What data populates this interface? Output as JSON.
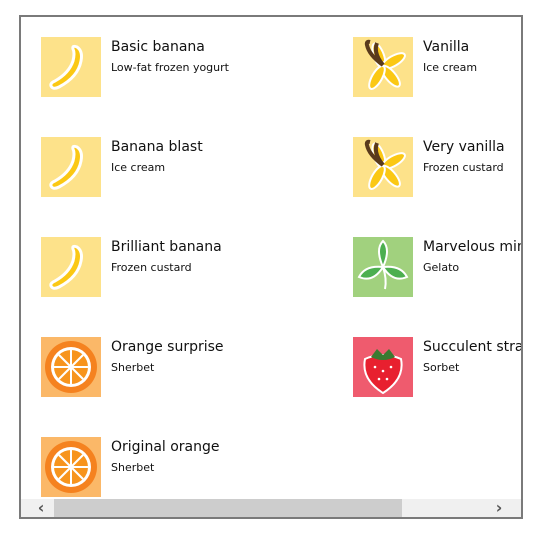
{
  "items": [
    {
      "title": "Basic banana",
      "subtitle": "Low-fat frozen yogurt",
      "icon": "banana-icon",
      "bg": "#fde28a"
    },
    {
      "title": "Banana blast",
      "subtitle": "Ice cream",
      "icon": "banana-icon",
      "bg": "#fde28a"
    },
    {
      "title": "Brilliant banana",
      "subtitle": "Frozen custard",
      "icon": "banana-icon",
      "bg": "#fde28a"
    },
    {
      "title": "Orange surprise",
      "subtitle": "Sherbet",
      "icon": "orange-icon",
      "bg": "#fbb868"
    },
    {
      "title": "Original orange",
      "subtitle": "Sherbet",
      "icon": "orange-icon",
      "bg": "#fbb868"
    },
    {
      "title": "Vanilla",
      "subtitle": "Ice cream",
      "icon": "vanilla-icon",
      "bg": "#fde28a"
    },
    {
      "title": "Very vanilla",
      "subtitle": "Frozen custard",
      "icon": "vanilla-icon",
      "bg": "#fde28a"
    },
    {
      "title": "Marvelous mint",
      "subtitle": "Gelato",
      "icon": "mint-icon",
      "bg": "#a1d17e"
    },
    {
      "title": "Succulent strawberry",
      "subtitle": "Sorbet",
      "icon": "strawberry-icon",
      "bg": "#ef5b6e"
    }
  ],
  "scrollbar": {
    "left": "chevron-left-icon",
    "right": "chevron-right-icon",
    "left_glyph": "‹",
    "right_glyph": "›"
  }
}
